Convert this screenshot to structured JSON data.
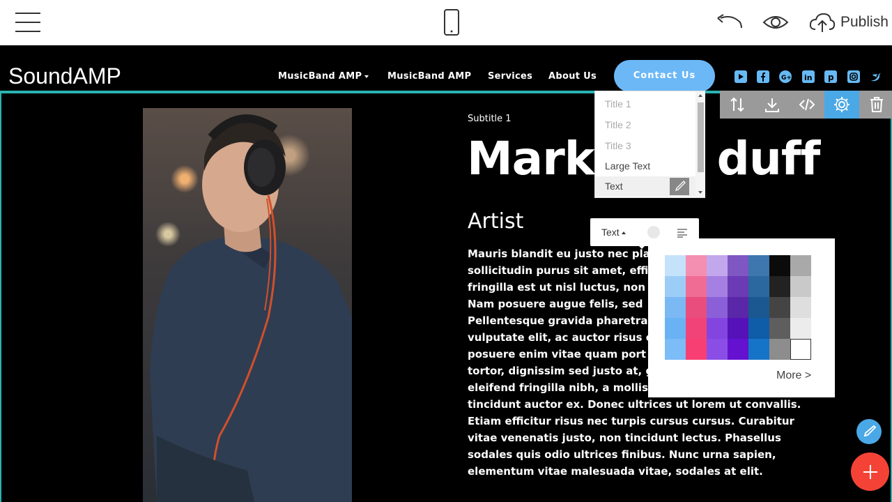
{
  "editor": {
    "publish_label": "Publish",
    "icons": [
      "hamburger-menu-icon",
      "mobile-view-icon",
      "undo-icon",
      "preview-eye-icon",
      "cloud-upload-icon"
    ]
  },
  "site": {
    "brand": "SoundAMP",
    "nav": [
      {
        "label": "MusicBand AMP",
        "has_dropdown": true
      },
      {
        "label": "MusicBand AMP",
        "has_dropdown": false
      },
      {
        "label": "Services",
        "has_dropdown": false
      },
      {
        "label": "About Us",
        "has_dropdown": false
      }
    ],
    "contact_button": "Contact Us",
    "social_icons": [
      "youtube-icon",
      "facebook-icon",
      "google-plus-icon",
      "linkedin-icon",
      "pinterest-icon",
      "instagram-icon",
      "twitter-icon"
    ],
    "accent_color": "#6cb8f7",
    "outline_color": "#2ab3b0"
  },
  "content": {
    "subtitle": "Subtitle 1",
    "headline_left": "Mark",
    "headline_right": "duff",
    "artist": "Artist",
    "body_lines": [
      "Mauris blandit eu justo nec pla",
      "sollicitudin purus sit amet, effi",
      "fringilla est ut nisl luctus, non a",
      "Nam posuere augue felis, sed",
      "Pellentesque gravida pharetra",
      "vulputate elit, ac auctor risus e",
      "posuere enim vitae quam port",
      "tortor, dignissim sed justo at, g",
      "eleifend fringilla nibh, a mollis",
      "tincidunt auctor ex. Donec ultrices ut lorem ut convallis.",
      "Etiam efficitur risus nec turpis cursus cursus. Curabitur",
      "vitae venenatis justo, non tincidunt lectus. Phasellus",
      "sodales quis odio ultrices finibus. Nunc urna sapien,",
      "elementum vitae malesuada vitae, sodales at elit."
    ]
  },
  "block_tools": [
    "sort-arrows-icon",
    "download-icon",
    "code-icon",
    "gear-icon",
    "trash-icon"
  ],
  "style_dropdown": {
    "items": [
      "Title 1",
      "Title 2",
      "Title 3",
      "Large Text",
      "Text"
    ],
    "selected": "Text"
  },
  "format_bar": {
    "style_label": "Text"
  },
  "color_picker": {
    "swatches": [
      [
        "#c5e2fb",
        "#f48fb1",
        "#c3a7ec",
        "#7e57c2",
        "#3d77ad",
        "#0b0b0b",
        "#a9a9a9"
      ],
      [
        "#9ccdf7",
        "#f06c95",
        "#a67fe2",
        "#6a3bb4",
        "#2b68a0",
        "#222222",
        "#c9c9c9"
      ],
      [
        "#7ab9f4",
        "#e94d7e",
        "#8b5fd8",
        "#5a27a8",
        "#1b5891",
        "#444444",
        "#dedede"
      ],
      [
        "#69b3f5",
        "#f24379",
        "#8344e0",
        "#5412b8",
        "#0f5ca8",
        "#5e5e5e",
        "#ececec"
      ],
      [
        "#7cbcf7",
        "#f83f74",
        "#8a4ee6",
        "#6412d0",
        "#1674c8",
        "#8d8d8d",
        "#ffffff"
      ]
    ],
    "more_label": "More >"
  },
  "fab": {
    "brush_icon": "brush-icon",
    "add_icon": "plus-icon"
  }
}
